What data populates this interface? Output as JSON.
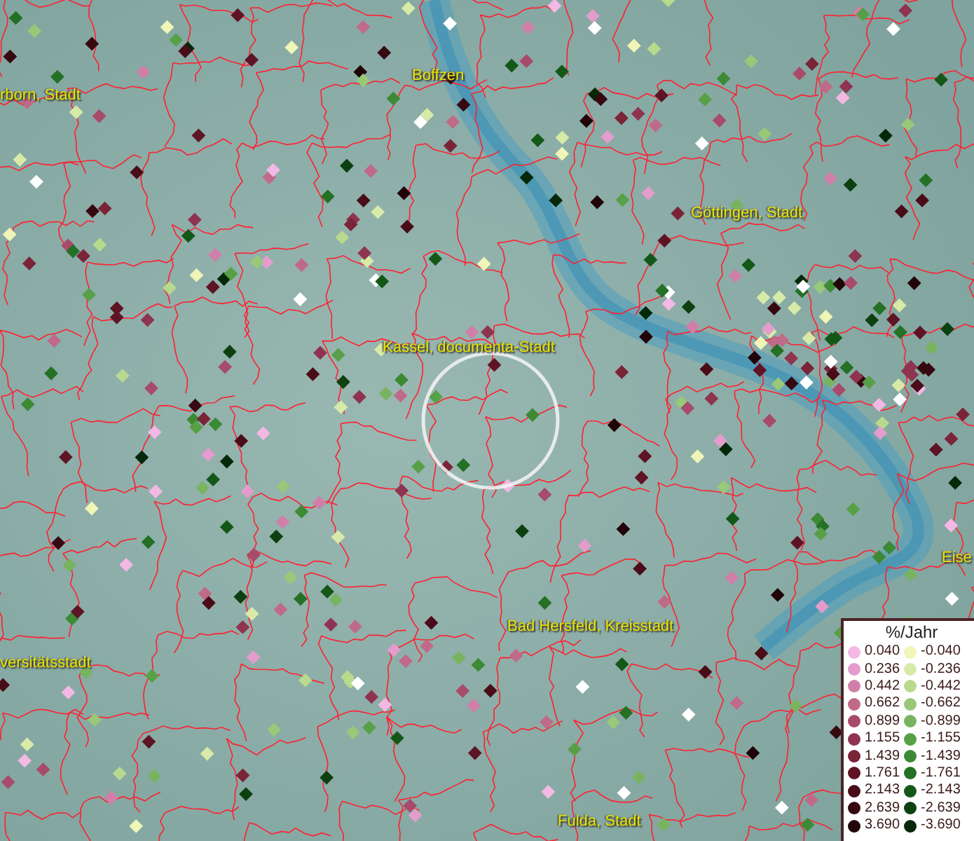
{
  "map": {
    "place_labels": [
      {
        "text": "rborn, Stadt"
      },
      {
        "text": "Boffzen"
      },
      {
        "text": "Göttingen, Stadt"
      },
      {
        "text": "Kassel, documenta-Stadt"
      },
      {
        "text": "Eise"
      },
      {
        "text": "versitätsstadt"
      },
      {
        "text": "Bad Hersfeld, Kreisstadt"
      },
      {
        "text": "Fulda, Stadt"
      }
    ]
  },
  "legend": {
    "title": "%/Jahr",
    "columns": [
      [
        {
          "value": "0.040",
          "color": "#f4b8e4"
        },
        {
          "value": "0.236",
          "color": "#e39ccb"
        },
        {
          "value": "0.442",
          "color": "#d07fa8"
        },
        {
          "value": "0.662",
          "color": "#c06a8a"
        },
        {
          "value": "0.899",
          "color": "#a84a6a"
        },
        {
          "value": "1.155",
          "color": "#8e3450"
        },
        {
          "value": "1.439",
          "color": "#7a2438"
        },
        {
          "value": "1.761",
          "color": "#5e1424"
        },
        {
          "value": "2.143",
          "color": "#4a0c18"
        },
        {
          "value": "2.639",
          "color": "#360810"
        },
        {
          "value": "3.690",
          "color": "#200408"
        }
      ],
      [
        {
          "value": "-0.040",
          "color": "#f0f5b8"
        },
        {
          "value": "-0.236",
          "color": "#d8eaa8"
        },
        {
          "value": "-0.442",
          "color": "#b8da8c"
        },
        {
          "value": "-0.662",
          "color": "#98c878"
        },
        {
          "value": "-0.899",
          "color": "#78b460"
        },
        {
          "value": "-1.155",
          "color": "#58a048"
        },
        {
          "value": "-1.439",
          "color": "#3c8a34"
        },
        {
          "value": "-1.761",
          "color": "#247024"
        },
        {
          "value": "-2.143",
          "color": "#145818"
        },
        {
          "value": "-2.639",
          "color": "#0c4010"
        },
        {
          "value": "-3.690",
          "color": "#042808"
        }
      ]
    ]
  }
}
